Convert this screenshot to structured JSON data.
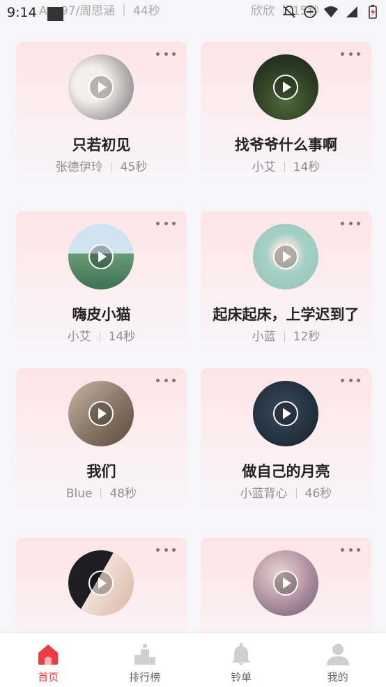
{
  "status_bar": {
    "time": "9:14"
  },
  "ghost_row": {
    "left": {
      "artist": "Ayo97/周思涵",
      "duration": "44秒"
    },
    "right": {
      "artist": "欣欣",
      "duration": "15秒"
    }
  },
  "cards": [
    {
      "title": "只若初见",
      "artist": "张德伊玲",
      "duration": "45秒"
    },
    {
      "title": "找爷爷什么事啊",
      "artist": "小艾",
      "duration": "14秒"
    },
    {
      "title": "嗨皮小猫",
      "artist": "小艾",
      "duration": "14秒"
    },
    {
      "title": "起床起床，上学迟到了",
      "artist": "小蓝",
      "duration": "12秒"
    },
    {
      "title": "我们",
      "artist": "Blue",
      "duration": "48秒"
    },
    {
      "title": "做自己的月亮",
      "artist": "小蓝背心",
      "duration": "46秒"
    },
    {
      "title": "",
      "artist": "",
      "duration": ""
    },
    {
      "title": "",
      "artist": "",
      "duration": ""
    }
  ],
  "bottom_nav": [
    {
      "label": "首页",
      "icon": "home-icon",
      "active": true
    },
    {
      "label": "排行榜",
      "icon": "podium-icon",
      "active": false
    },
    {
      "label": "铃单",
      "icon": "bell-icon",
      "active": false
    },
    {
      "label": "我的",
      "icon": "person-icon",
      "active": false
    }
  ],
  "colors": {
    "accent": "#ee3b48",
    "card_top": "#fde4e7",
    "nav_inactive": "#cfcfd3"
  }
}
